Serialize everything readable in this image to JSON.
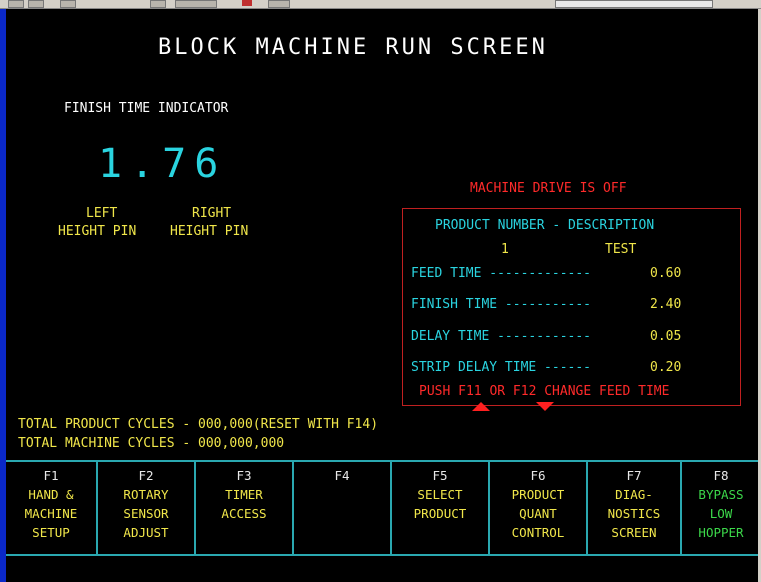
{
  "title": "BLOCK MACHINE RUN SCREEN",
  "finish_time": {
    "label": "FINISH TIME INDICATOR",
    "value": "1.76"
  },
  "height_pins": {
    "left_line1": "LEFT",
    "left_line2": "HEIGHT PIN",
    "right_line1": "RIGHT",
    "right_line2": "HEIGHT PIN"
  },
  "machine_status": "MACHINE DRIVE IS OFF",
  "product_panel": {
    "header": "PRODUCT NUMBER - DESCRIPTION",
    "product_number": "1",
    "description": "TEST",
    "rows": [
      {
        "label": "FEED TIME -------------",
        "value": "0.60"
      },
      {
        "label": "FINISH TIME -----------",
        "value": "2.40"
      },
      {
        "label": "DELAY TIME ------------",
        "value": "0.05"
      },
      {
        "label": "STRIP DELAY TIME ------",
        "value": "0.20"
      }
    ],
    "hint": "PUSH F11 OR F12 CHANGE FEED TIME"
  },
  "cycles": {
    "product": "TOTAL PRODUCT CYCLES - 000,000(RESET WITH F14)",
    "machine": "TOTAL MACHINE CYCLES - 000,000,000"
  },
  "function_keys": [
    {
      "key": "F1",
      "lines": [
        "HAND &",
        "MACHINE",
        "SETUP"
      ]
    },
    {
      "key": "F2",
      "lines": [
        "ROTARY",
        "SENSOR",
        "ADJUST"
      ]
    },
    {
      "key": "F3",
      "lines": [
        "TIMER",
        "ACCESS",
        ""
      ]
    },
    {
      "key": "F4",
      "lines": [
        "",
        "",
        ""
      ]
    },
    {
      "key": "F5",
      "lines": [
        "SELECT",
        "PRODUCT",
        ""
      ]
    },
    {
      "key": "F6",
      "lines": [
        "PRODUCT",
        "QUANT",
        "CONTROL"
      ]
    },
    {
      "key": "F7",
      "lines": [
        "DIAG-",
        "NOSTICS",
        "SCREEN"
      ]
    },
    {
      "key": "F8",
      "lines": [
        "BYPASS",
        "LOW",
        "HOPPER"
      ]
    }
  ],
  "colors": {
    "background": "#000000",
    "title": "#ffffff",
    "value": "#2ad4e0",
    "label": "#f0e64a",
    "alert": "#ff2a2a",
    "bypass": "#3cd84a",
    "frame": "#2aa8b0"
  }
}
